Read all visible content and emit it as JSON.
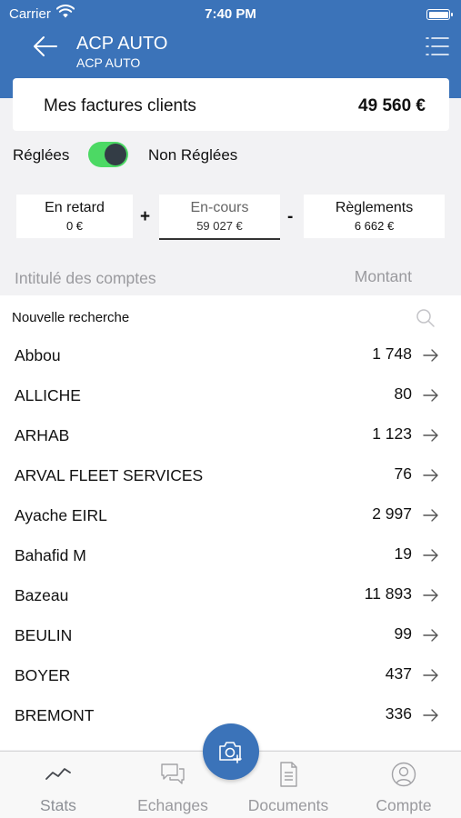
{
  "status_bar": {
    "carrier": "Carrier",
    "time": "7:40 PM"
  },
  "header": {
    "title": "ACP AUTO",
    "subtitle": "ACP AUTO"
  },
  "summary": {
    "label": "Mes factures clients",
    "amount": "49 560 €"
  },
  "toggle": {
    "left_label": "Réglées",
    "right_label": "Non Réglées",
    "state": "on"
  },
  "cards": {
    "late": {
      "title": "En retard",
      "value": "0 €"
    },
    "current": {
      "title": "En-cours",
      "value": "59 027 €"
    },
    "payments": {
      "title": "Règlements",
      "value": "6 662 €"
    },
    "plus": "+",
    "minus": "-"
  },
  "columns": {
    "name": "Intitulé des comptes",
    "amount": "Montant"
  },
  "search": {
    "label": "Nouvelle recherche"
  },
  "accounts": [
    {
      "name": "Abbou",
      "amount": "1 748"
    },
    {
      "name": "ALLICHE",
      "amount": "80"
    },
    {
      "name": "ARHAB",
      "amount": "1 123"
    },
    {
      "name": "ARVAL FLEET SERVICES",
      "amount": "76"
    },
    {
      "name": "Ayache EIRL",
      "amount": "2 997"
    },
    {
      "name": "Bahafid M",
      "amount": "19"
    },
    {
      "name": "Bazeau",
      "amount": "11 893"
    },
    {
      "name": "BEULIN",
      "amount": "99"
    },
    {
      "name": "BOYER",
      "amount": "437"
    },
    {
      "name": "BREMONT",
      "amount": "336"
    }
  ],
  "tabs": {
    "stats": "Stats",
    "exchanges": "Echanges",
    "documents": "Documents",
    "account": "Compte"
  },
  "colors": {
    "brand": "#3b73b9",
    "toggle_on": "#4cd964",
    "muted": "#9a9a9e"
  }
}
